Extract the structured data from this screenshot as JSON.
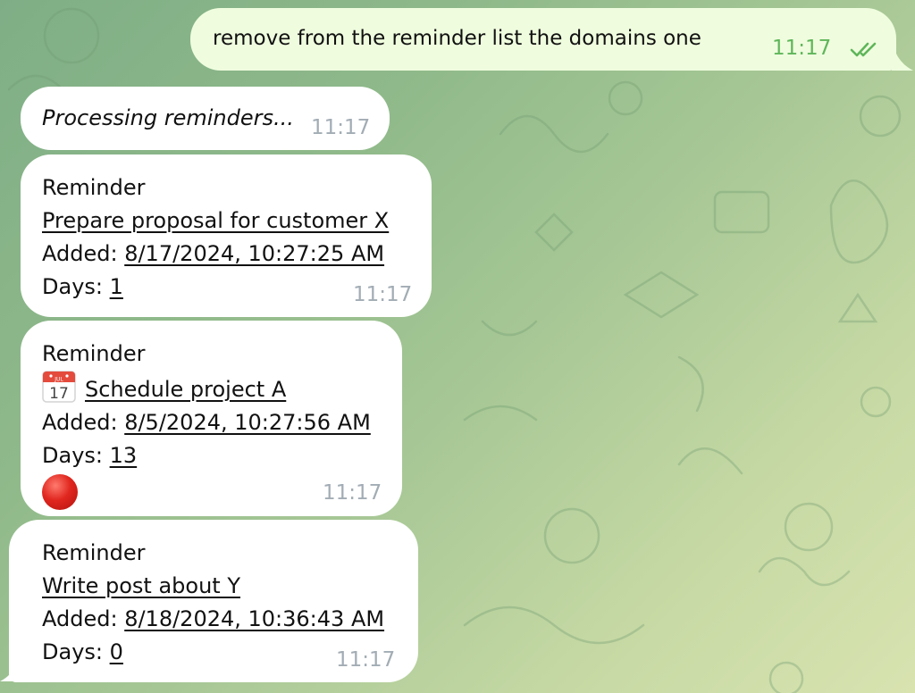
{
  "outgoing": {
    "text": "remove from the reminder list the domains one",
    "time": "11:17",
    "status_icon": "double-check-icon"
  },
  "processing": {
    "text": "Processing reminders...",
    "time": "11:17"
  },
  "reminders": [
    {
      "heading": "Reminder",
      "title": "Prepare proposal for customer X",
      "added_label": "Added:",
      "added": "8/17/2024, 10:27:25 AM",
      "days_label": "Days:",
      "days": "1",
      "time": "11:17"
    },
    {
      "heading": "Reminder",
      "title_icon": "calendar-icon",
      "title": "Schedule project A",
      "added_label": "Added:",
      "added": "8/5/2024, 10:27:56 AM",
      "days_label": "Days:",
      "days": "13",
      "status_icon": "red-circle-icon",
      "time": "11:17"
    },
    {
      "heading": "Reminder",
      "title": "Write post about Y",
      "added_label": "Added:",
      "added": "8/18/2024, 10:36:43 AM",
      "days_label": "Days:",
      "days": "0",
      "time": "11:17"
    }
  ],
  "colors": {
    "incoming_bubble": "#ffffff",
    "outgoing_bubble": "#effdde",
    "outgoing_time": "#5fb65a",
    "incoming_time": "#a2acb4"
  }
}
